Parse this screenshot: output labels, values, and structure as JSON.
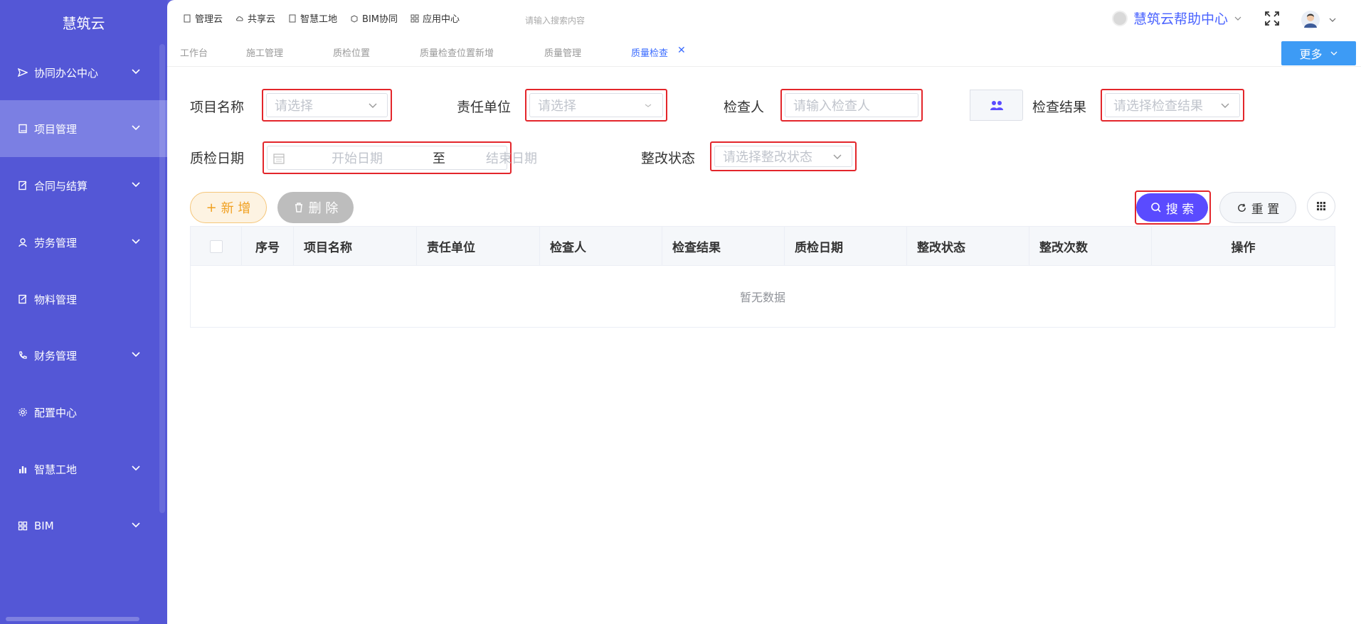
{
  "sidebar": {
    "brand": "慧筑云",
    "items": [
      {
        "label": "协同办公中心",
        "icon": "send-icon",
        "chevron": true
      },
      {
        "label": "项目管理",
        "icon": "book-icon",
        "chevron": true,
        "active": true
      },
      {
        "label": "合同与结算",
        "icon": "edit-doc-icon",
        "chevron": true
      },
      {
        "label": "劳务管理",
        "icon": "user-icon",
        "chevron": true
      },
      {
        "label": "物料管理",
        "icon": "edit-doc-icon",
        "chevron": false
      },
      {
        "label": "财务管理",
        "icon": "phone-icon",
        "chevron": true
      },
      {
        "label": "配置中心",
        "icon": "gear-icon",
        "chevron": false
      },
      {
        "label": "智慧工地",
        "icon": "bar-chart-icon",
        "chevron": true
      },
      {
        "label": "BIM",
        "icon": "grid-icon",
        "chevron": true
      }
    ]
  },
  "topbar": {
    "links": [
      {
        "label": "管理云",
        "icon": "book-icon"
      },
      {
        "label": "共享云",
        "icon": "cloud-icon"
      },
      {
        "label": "智慧工地",
        "icon": "book-icon"
      },
      {
        "label": "BIM协同",
        "icon": "cube-icon"
      },
      {
        "label": "应用中心",
        "icon": "grid-icon"
      }
    ],
    "search_placeholder": "请输入搜索内容",
    "help_center": "慧筑云帮助中心"
  },
  "tabs": [
    {
      "label": "工作台"
    },
    {
      "label": "施工管理"
    },
    {
      "label": "质检位置"
    },
    {
      "label": "质量检查位置新增"
    },
    {
      "label": "质量管理"
    },
    {
      "label": "质量检查",
      "active": true
    }
  ],
  "more_button": "更多",
  "filters": {
    "project_name": {
      "label": "项目名称",
      "placeholder": "请选择"
    },
    "responsible_unit": {
      "label": "责任单位",
      "placeholder": "请选择"
    },
    "inspector": {
      "label": "检查人",
      "placeholder": "请输入检查人"
    },
    "inspection_result": {
      "label": "检查结果",
      "placeholder": "请选择检查结果"
    },
    "inspection_date": {
      "label": "质检日期",
      "start_placeholder": "开始日期",
      "separator": "至",
      "end_placeholder": "结束日期"
    },
    "rectify_status": {
      "label": "整改状态",
      "placeholder": "请选择整改状态"
    }
  },
  "actions": {
    "add": "新 增",
    "delete": "删 除",
    "search": "搜 索",
    "reset": "重 置"
  },
  "table": {
    "columns": [
      "序号",
      "项目名称",
      "责任单位",
      "检查人",
      "检查结果",
      "质检日期",
      "整改状态",
      "整改次数",
      "操作"
    ],
    "empty_text": "暂无数据"
  },
  "colors": {
    "sidebar": "#5457d6",
    "sidebar_active": "#7b7fe3",
    "primary": "#5a4bff",
    "link_blue": "#3b6cff",
    "highlight_red": "#e3262b"
  }
}
